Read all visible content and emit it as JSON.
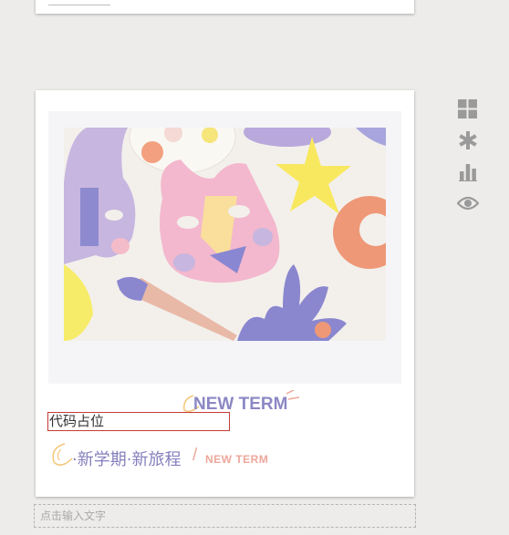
{
  "editor": {
    "code_placeholder": "代码占位",
    "subtitle": "·新学期·新旅程",
    "subtitle_slash": "/",
    "subtitle_en": "NEW TERM",
    "image_caption": "NEW TERM",
    "text_input_placeholder": "点击输入文字"
  },
  "toolbar": {
    "items": [
      {
        "icon": "grid-icon"
      },
      {
        "icon": "asterisk-icon"
      },
      {
        "icon": "bar-chart-icon"
      },
      {
        "icon": "eye-icon"
      }
    ]
  },
  "colors": {
    "background": "#edecea",
    "card": "#ffffff",
    "accent_purple": "#8c87c4",
    "accent_salmon": "#eea79b",
    "selection_border": "#c53b35",
    "toolbar_icon": "#9a9a9a"
  }
}
